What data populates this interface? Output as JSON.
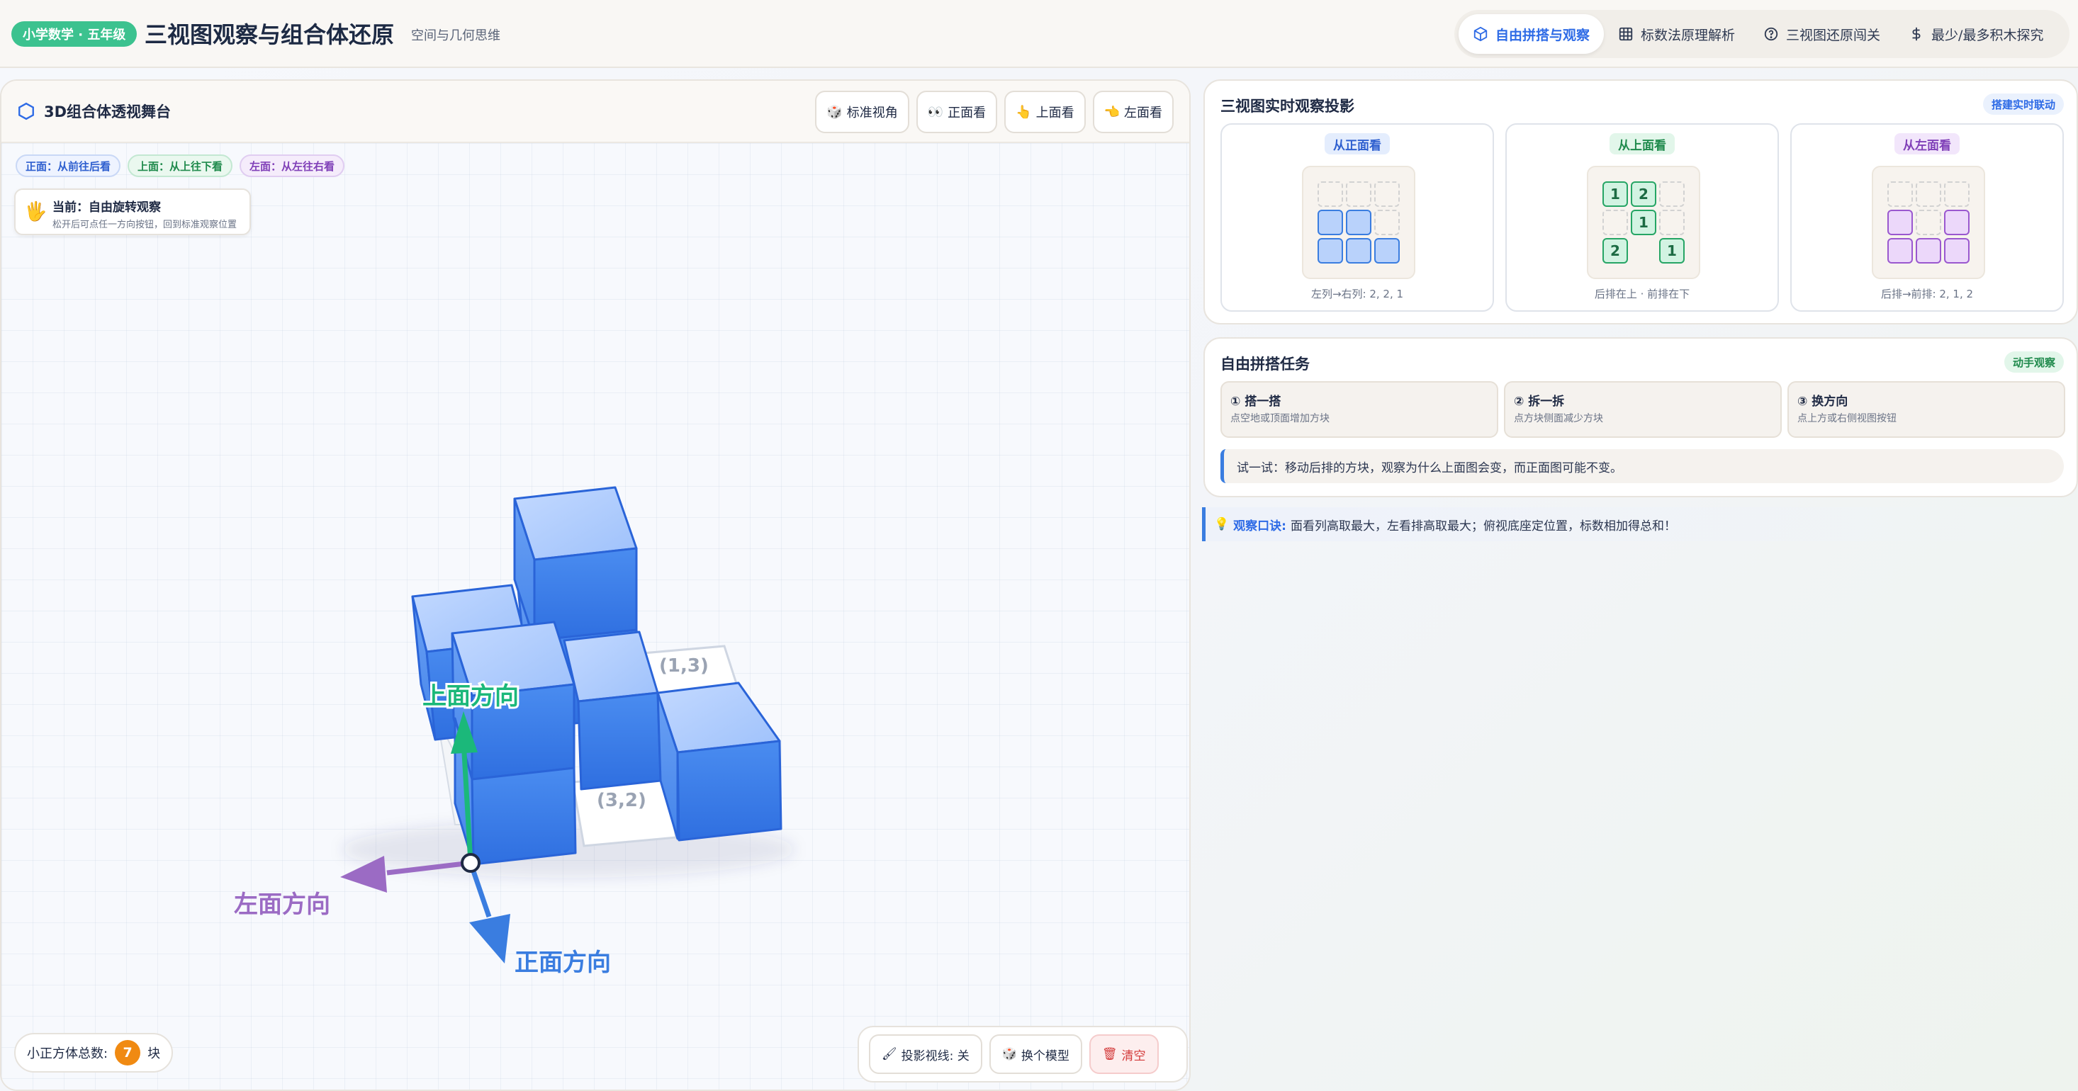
{
  "header": {
    "badge": "小学数学 · 五年级",
    "title": "三视图观察与组合体还原",
    "subtitle": "空间与几何思维",
    "tabs": [
      {
        "label": "自由拼搭与观察",
        "icon": "cube-icon",
        "active": true
      },
      {
        "label": "标数法原理解析",
        "icon": "grid-icon",
        "active": false
      },
      {
        "label": "三视图还原闯关",
        "icon": "question-circle-icon",
        "active": false
      },
      {
        "label": "最少/最多积木探究",
        "icon": "dollar-icon",
        "active": false
      }
    ]
  },
  "stage": {
    "title": "3D组合体透视舞台",
    "view_buttons": [
      {
        "icon": "🎲",
        "label": "标准视角"
      },
      {
        "icon": "👀",
        "label": "正面看"
      },
      {
        "icon": "👆",
        "label": "上面看"
      },
      {
        "icon": "👈",
        "label": "左面看"
      }
    ],
    "chips": {
      "front": "正面：从前往后看",
      "top": "上面：从上往下看",
      "left": "左面：从左往右看"
    },
    "current": {
      "icon": "🖐",
      "title": "当前：自由旋转观察",
      "desc": "松开后可点任一方向按钮，回到标准观察位置"
    },
    "scene": {
      "cell_labels": [
        "(1,3)",
        "(3,2)"
      ],
      "axis_top": "上面方向",
      "axis_left": "左面方向",
      "axis_front": "正面方向",
      "colors": {
        "top_axis": "#1bb87a",
        "left_axis": "#9b6bc4",
        "front_axis": "#3a7de0",
        "cube": "#3a7de0"
      }
    },
    "count": {
      "label": "小正方体总数:",
      "value": "7",
      "unit": "块"
    },
    "tools": [
      {
        "icon": "🖌",
        "label": "投影视线: 关"
      },
      {
        "icon": "🎲",
        "label": "换个模型"
      },
      {
        "icon": "🗑",
        "label": "清空"
      }
    ]
  },
  "projection": {
    "title": "三视图实时观察投影",
    "tag": "搭建实时联动",
    "views": [
      {
        "label": "从正面看",
        "caption": "左列→右列: 2, 2, 1",
        "cells": [
          [
            "empty",
            "empty",
            "empty"
          ],
          [
            "blue",
            "blue",
            "empty"
          ],
          [
            "blue",
            "blue",
            "blue"
          ]
        ],
        "numbers": [
          [
            "",
            "",
            ""
          ],
          [
            "",
            "",
            ""
          ],
          [
            "",
            "",
            ""
          ]
        ]
      },
      {
        "label": "从上面看",
        "caption": "后排在上 · 前排在下",
        "cells": [
          [
            "green",
            "green",
            "empty"
          ],
          [
            "empty",
            "green",
            "empty"
          ],
          [
            "green",
            "none",
            "green"
          ]
        ],
        "numbers": [
          [
            "1",
            "2",
            ""
          ],
          [
            "",
            "1",
            ""
          ],
          [
            "2",
            "",
            "1"
          ]
        ]
      },
      {
        "label": "从左面看",
        "caption": "后排→前排: 2, 1, 2",
        "cells": [
          [
            "empty",
            "empty",
            "empty"
          ],
          [
            "purple",
            "empty",
            "purple"
          ],
          [
            "purple",
            "purple",
            "purple"
          ]
        ],
        "numbers": [
          [
            "",
            "",
            ""
          ],
          [
            "",
            "",
            ""
          ],
          [
            "",
            "",
            ""
          ]
        ]
      }
    ]
  },
  "tasks": {
    "title": "自由拼搭任务",
    "tag": "动手观察",
    "items": [
      {
        "title": "① 搭一搭",
        "desc": "点空地或顶面增加方块"
      },
      {
        "title": "② 拆一拆",
        "desc": "点方块侧面减少方块"
      },
      {
        "title": "③ 换方向",
        "desc": "点上方或右侧视图按钮"
      }
    ],
    "try": "试一试：移动后排的方块，观察为什么上面图会变，而正面图可能不变。"
  },
  "tip": {
    "icon": "💡",
    "key": "观察口诀:",
    "text": "面看列高取最大，左看排高取最大；俯视底座定位置，标数相加得总和！"
  }
}
